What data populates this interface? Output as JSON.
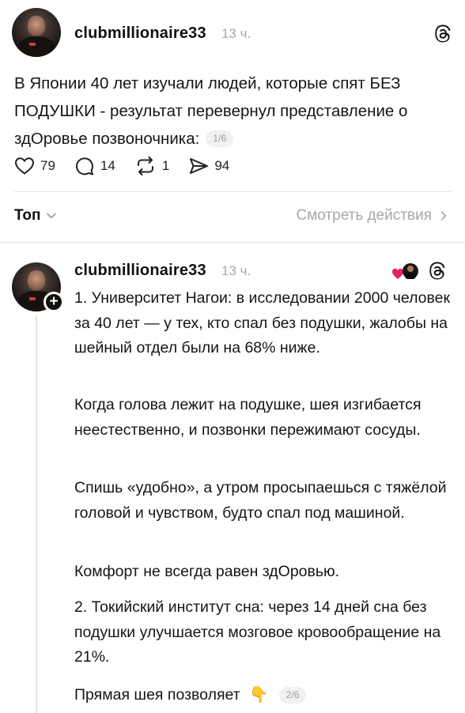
{
  "post": {
    "username": "clubmillionaire33",
    "time": "13 ч.",
    "text": "В Японии 40 лет изучали людей, которые спят БЕЗ ПОДУШКИ - результат перевернул представление о здОровье позвоночника:",
    "page_badge": "1/6",
    "actions": {
      "likes": "79",
      "comments": "14",
      "reposts": "1",
      "shares": "94"
    }
  },
  "sort_bar": {
    "sort_label": "Топ",
    "view_activity_label": "Смотреть действия"
  },
  "reply": {
    "username": "clubmillionaire33",
    "time": "13 ч.",
    "paragraphs": [
      "1. Университет Нагои: в исследовании 2000 человек за 40 лет — у тех, кто спал без подушки, жалобы на шейный отдел были на 68% ниже.",
      "Когда голова лежит на подушке, шея изгибается неестественно, и позвонки пережимают сосуды.",
      "Спишь «удобно», а утром просыпаешься с тяжёлой головой и чувством, будто спал под машиной.",
      "Комфорт не всегда равен здОровью.",
      "2. Токийский институт сна: через 14 дней сна без подушки улучшается мозговое кровообращение на 21%."
    ],
    "last_line": "Прямая шея позволяет",
    "last_emoji": "👇",
    "page_badge": "2/6"
  },
  "icons": {
    "threads": "threads-logo-icon",
    "like": "heart-outline-icon",
    "comment": "speech-bubble-icon",
    "repost": "repost-arrows-icon",
    "share": "paper-plane-icon",
    "chevron": "chevron-down-icon",
    "arrow": "chevron-right-icon",
    "follow": "plus-icon"
  },
  "colors": {
    "text": "#151515",
    "muted": "#a8a8a8",
    "divider": "#e4e4e4",
    "heart": "#e0245e"
  }
}
